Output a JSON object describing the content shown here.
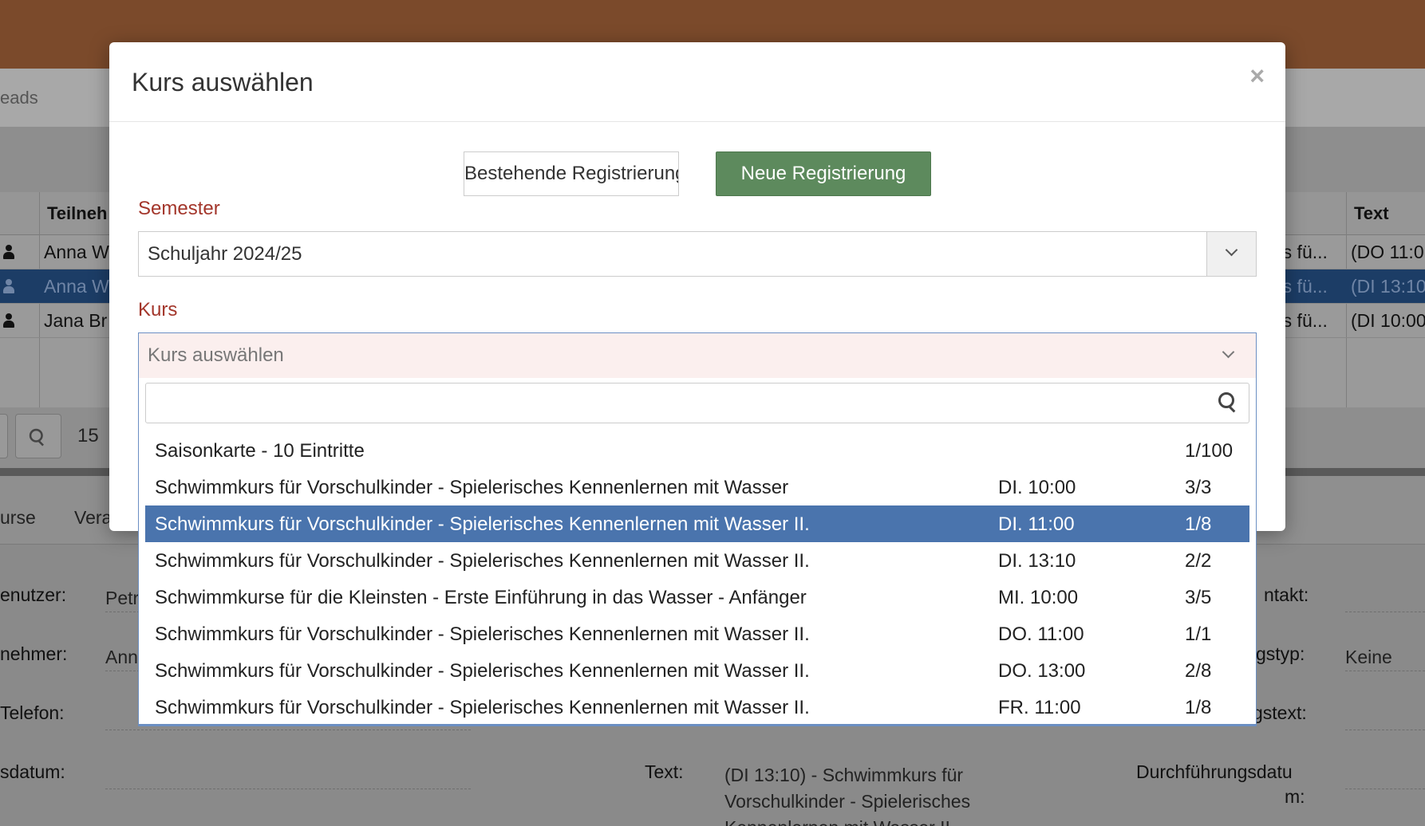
{
  "background": {
    "nav_crumb": "eads",
    "grid_headers": {
      "participant": "Teilneh",
      "text": "Text"
    },
    "rows": [
      {
        "name": "Anna W",
        "course": "rs fü...",
        "text": "(DO 11:0"
      },
      {
        "name": "Anna W",
        "course": "rs fü...",
        "text": "(DI 13:10"
      },
      {
        "name": "Jana Br",
        "course": "rs fü...",
        "text": "(DI 10:00"
      }
    ],
    "pager_count": "15",
    "tabs": [
      "urse",
      "Vera"
    ],
    "form": {
      "user_label": "enutzer:",
      "user_value": "Petr",
      "participant_label": "nehmer:",
      "participant_value": "Ann",
      "phone_label": "Telefon:",
      "date_label": "sdatum:",
      "contact_label": "ntakt:",
      "type_label": "gstyp:",
      "type_value": "Keine",
      "text2_label": "gstext:",
      "text_label": "Text:",
      "text_value_l1": "(DI 13:10) - Schwimmkurs für",
      "text_value_l2": "Vorschulkinder - Spielerisches",
      "text_value_l3": "Kennenlernen mit Wasser II.",
      "exec_date_l1": "Durchführungsdatu",
      "exec_date_l2": "m:"
    }
  },
  "modal": {
    "title": "Kurs auswählen",
    "close": "×",
    "btn_existing": "Bestehende Registrierung",
    "btn_new": "Neue Registrierung",
    "semester_label": "Semester",
    "semester_value": "Schuljahr 2024/25",
    "kurs_label": "Kurs",
    "kurs_placeholder": "Kurs auswählen"
  },
  "dropdown": {
    "items": [
      {
        "name": "Saisonkarte - 10 Eintritte",
        "time": "",
        "cap": "1/100"
      },
      {
        "name": "Schwimmkurs für Vorschulkinder - Spielerisches Kennenlernen mit Wasser",
        "time": "DI. 10:00",
        "cap": "3/3"
      },
      {
        "name": "Schwimmkurs für Vorschulkinder - Spielerisches Kennenlernen mit Wasser II.",
        "time": "DI. 11:00",
        "cap": "1/8"
      },
      {
        "name": "Schwimmkurs für Vorschulkinder - Spielerisches Kennenlernen mit Wasser II.",
        "time": "DI. 13:10",
        "cap": "2/2"
      },
      {
        "name": "Schwimmkurse für die Kleinsten - Erste Einführung in das Wasser - Anfänger",
        "time": "MI. 10:00",
        "cap": "3/5"
      },
      {
        "name": "Schwimmkurs für Vorschulkinder - Spielerisches Kennenlernen mit Wasser II.",
        "time": "DO. 11:00",
        "cap": "1/1"
      },
      {
        "name": "Schwimmkurs für Vorschulkinder - Spielerisches Kennenlernen mit Wasser II.",
        "time": "DO. 13:00",
        "cap": "2/8"
      },
      {
        "name": "Schwimmkurs für Vorschulkinder - Spielerisches Kennenlernen mit Wasser II.",
        "time": "FR. 11:00",
        "cap": "1/8"
      }
    ]
  }
}
